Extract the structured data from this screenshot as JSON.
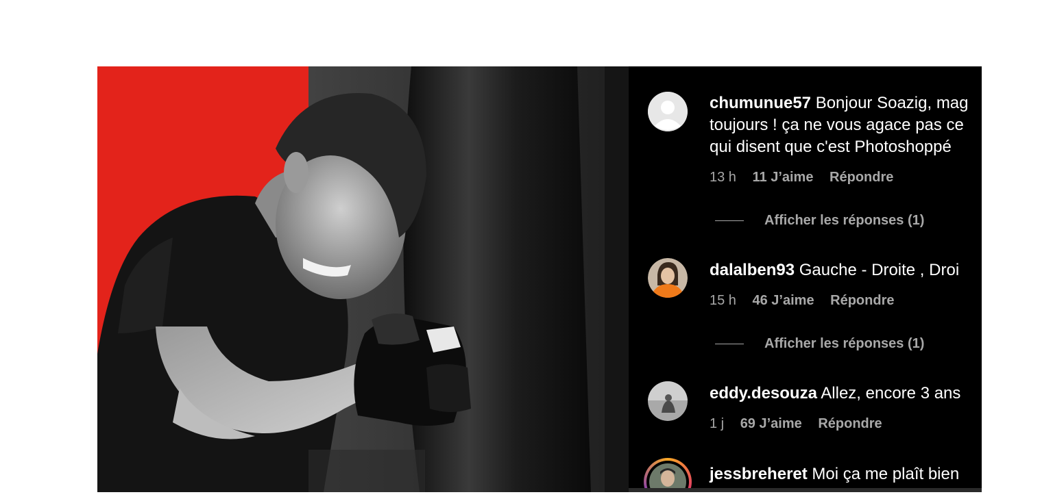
{
  "comments": [
    {
      "username": "chumunue57",
      "text_lines": [
        "Bonjour Soazig, mag",
        "toujours ! ça ne vous agace pas ce",
        "qui disent que c'est Photoshoppé"
      ],
      "time": "13 h",
      "likes": "11 J’aime",
      "reply": "Répondre",
      "view_replies": "Afficher les réponses (1)",
      "avatar": "default-avatar-icon"
    },
    {
      "username": "dalalben93",
      "text_lines": [
        "Gauche - Droite , Droi"
      ],
      "time": "15 h",
      "likes": "46 J’aime",
      "reply": "Répondre",
      "view_replies": "Afficher les réponses (1)",
      "avatar": "user-photo-orange"
    },
    {
      "username": "eddy.desouza",
      "text_lines": [
        "Allez, encore 3 ans"
      ],
      "time": "1 j",
      "likes": "69 J’aime",
      "reply": "Répondre",
      "avatar": "user-photo-grey"
    },
    {
      "username": "jessbreheret",
      "text_lines": [
        "Moi ça me plaît bien"
      ],
      "avatar": "story-ring-avatar"
    }
  ],
  "colors": {
    "red_panel": "#e3231b",
    "comments_bg": "#000000",
    "meta_text": "#a8a8a8",
    "story_ring": "#e1306c"
  }
}
